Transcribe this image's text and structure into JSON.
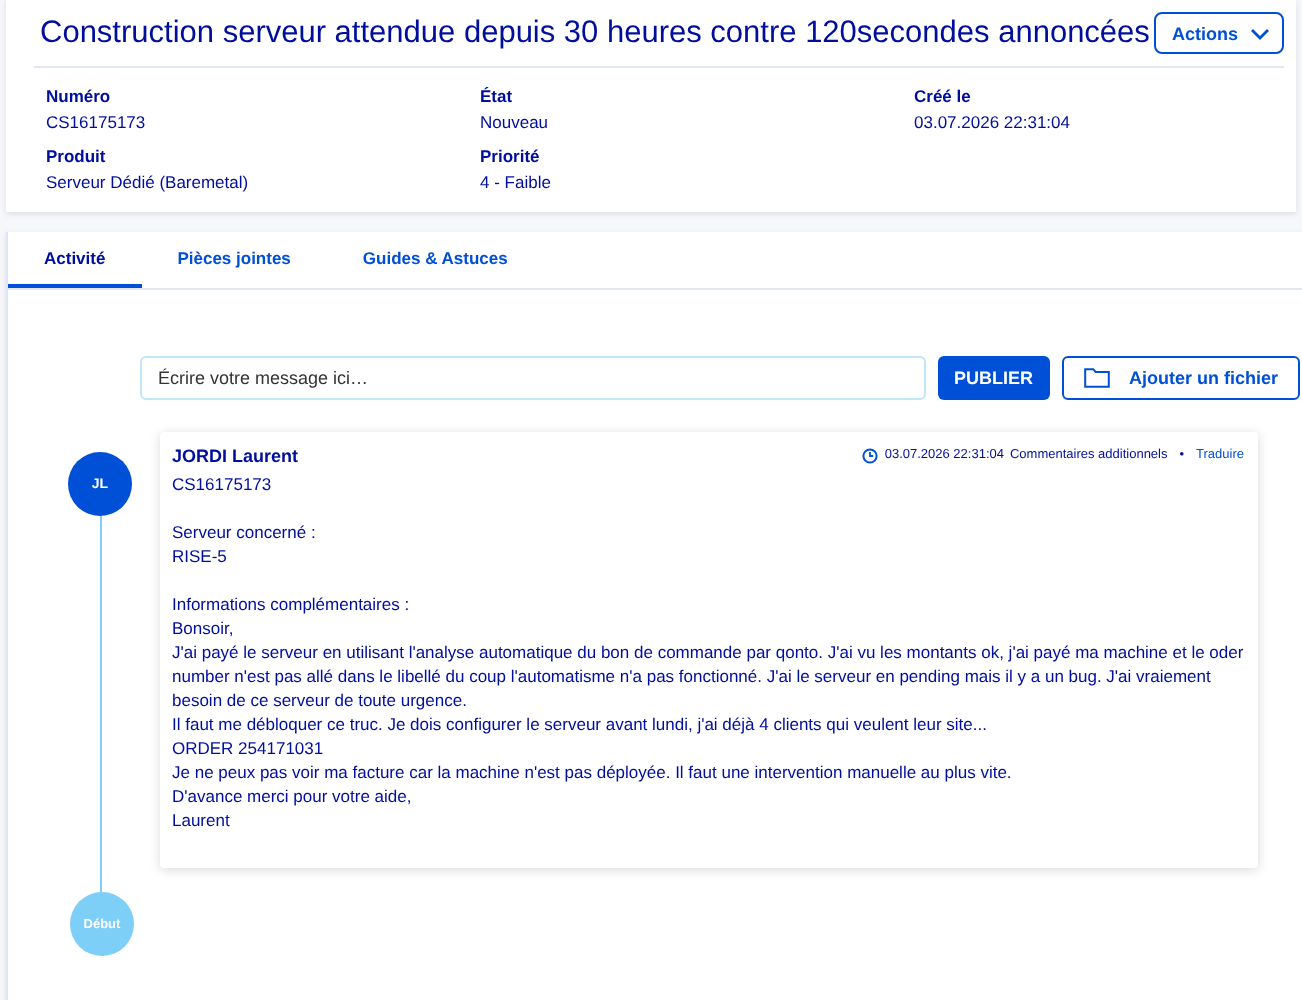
{
  "title": "Construction serveur attendue depuis 30 heures contre 120secondes annoncées",
  "actions_button": "Actions",
  "fields": [
    {
      "label": "Numéro",
      "value": "CS16175173"
    },
    {
      "label": "État",
      "value": "Nouveau"
    },
    {
      "label": "Créé le",
      "value": "03.07.2026 22:31:04"
    },
    {
      "label": "Produit",
      "value": "Serveur Dédié (Baremetal)"
    },
    {
      "label": "Priorité",
      "value": "4 - Faible"
    }
  ],
  "tabs": [
    {
      "label": "Activité",
      "selected": true
    },
    {
      "label": "Pièces jointes",
      "selected": false
    },
    {
      "label": "Guides & Astuces",
      "selected": false
    }
  ],
  "composer": {
    "placeholder": "Écrire votre message ici…",
    "publish_button": "PUBLIER",
    "attach_button": "Ajouter un fichier"
  },
  "message": {
    "initials": "JL",
    "author": "JORDI Laurent",
    "time": "03.07.2026 22:31:04",
    "category": "Commentaires additionnels",
    "separator": "•",
    "translate_link": "Traduire",
    "paragraphs": [
      [
        "CS16175173"
      ],
      [
        "Serveur concerné :",
        "RISE-5"
      ],
      [
        "Informations complémentaires :",
        "Bonsoir,",
        "J'ai payé le serveur en utilisant l'analyse automatique du bon de commande par qonto. J'ai vu les montants ok, j'ai payé ma machine et le oder number n'est pas allé dans le libellé du coup l'automatisme n'a pas fonctionné. J'ai le serveur en pending mais il y a un bug. J'ai vraiement besoin de ce serveur de toute urgence.",
        "Il faut me débloquer ce truc. Je dois configurer le serveur avant lundi, j'ai déjà 4 clients qui veulent leur site...",
        "ORDER 254171031",
        "Je ne peux pas voir ma facture car la machine n'est pas déployée. Il faut une intervention manuelle au plus vite.",
        "D'avance merci pour votre aide,",
        "Laurent"
      ]
    ]
  },
  "timeline_start": "Début"
}
